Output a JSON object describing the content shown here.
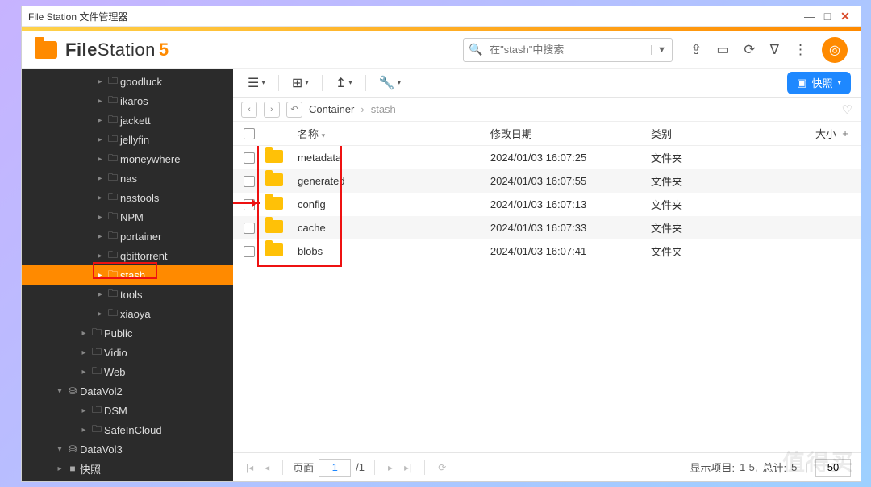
{
  "window": {
    "title": "File Station 文件管理器"
  },
  "logo": {
    "bold": "File",
    "light": "Station",
    "ver": "5"
  },
  "search": {
    "placeholder": "在\"stash\"中搜索"
  },
  "snapshot": {
    "label": "快照"
  },
  "breadcrumb": {
    "root": "Container",
    "current": "stash"
  },
  "columns": {
    "name": "名称",
    "date": "修改日期",
    "type": "类别",
    "size": "大小"
  },
  "tree": {
    "items": [
      {
        "label": "goodluck",
        "depth": 2
      },
      {
        "label": "ikaros",
        "depth": 2
      },
      {
        "label": "jackett",
        "depth": 2
      },
      {
        "label": "jellyfin",
        "depth": 2
      },
      {
        "label": "moneywhere",
        "depth": 2
      },
      {
        "label": "nas",
        "depth": 2
      },
      {
        "label": "nastools",
        "depth": 2
      },
      {
        "label": "NPM",
        "depth": 2
      },
      {
        "label": "portainer",
        "depth": 2
      },
      {
        "label": "qbittorrent",
        "depth": 2
      },
      {
        "label": "stash",
        "depth": 2,
        "sel": true
      },
      {
        "label": "tools",
        "depth": 2
      },
      {
        "label": "xiaoya",
        "depth": 2
      },
      {
        "label": "Public",
        "depth": 1
      },
      {
        "label": "Vidio",
        "depth": 1
      },
      {
        "label": "Web",
        "depth": 1
      }
    ],
    "vols": [
      {
        "label": "DataVol2",
        "items": [
          {
            "label": "DSM"
          },
          {
            "label": "SafeInCloud"
          }
        ]
      },
      {
        "label": "DataVol3",
        "items": []
      }
    ],
    "snapshot_root": "快照"
  },
  "rows": [
    {
      "name": "metadata",
      "date": "2024/01/03 16:07:25",
      "type": "文件夹"
    },
    {
      "name": "generated",
      "date": "2024/01/03 16:07:55",
      "type": "文件夹"
    },
    {
      "name": "config",
      "date": "2024/01/03 16:07:13",
      "type": "文件夹"
    },
    {
      "name": "cache",
      "date": "2024/01/03 16:07:33",
      "type": "文件夹"
    },
    {
      "name": "blobs",
      "date": "2024/01/03 16:07:41",
      "type": "文件夹"
    }
  ],
  "pager": {
    "page_label": "页面",
    "page": "1",
    "total": "/1",
    "status_prefix": "显示项目:",
    "range": "1-5,",
    "total_label": "总计:",
    "total_count": "5",
    "perpage": "50"
  },
  "watermark": "值得买"
}
